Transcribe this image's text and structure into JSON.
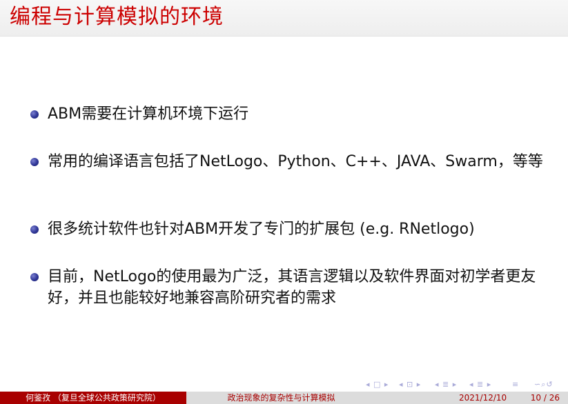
{
  "slide": {
    "title": "编程与计算模拟的环境",
    "bullets": [
      {
        "text": "ABM需要在计算机环境下运行"
      },
      {
        "text": "常用的编译语言包括了NetLogo、Python、C++、JAVA、Swarm，等等"
      },
      {
        "text": "很多统计软件也针对ABM开发了专门的扩展包 (e.g. RNetlogo)"
      },
      {
        "text": "目前，NetLogo的使用最为广泛，其语言逻辑以及软件界面对初学者更友好，并且也能较好地兼容高阶研究者的需求"
      }
    ]
  },
  "footer": {
    "author": "何鉴孜 （复旦全球公共政策研究院）",
    "talk_title": "政治现象的复杂性与计算模拟",
    "date": "2021/12/10",
    "page": "10 / 26"
  },
  "navigation": {
    "first": "◂ □ ▸",
    "section": "◂ ⊡ ▸",
    "subsection": "◂ ≣ ▸",
    "frame": "◂ ≣ ▸",
    "align": "≡",
    "search": "∽⌕↺"
  },
  "colors": {
    "title": "#cc0000",
    "footer_author_bg": "#a80000",
    "footer_text": "#a80000",
    "bullet": "#2e3596"
  }
}
